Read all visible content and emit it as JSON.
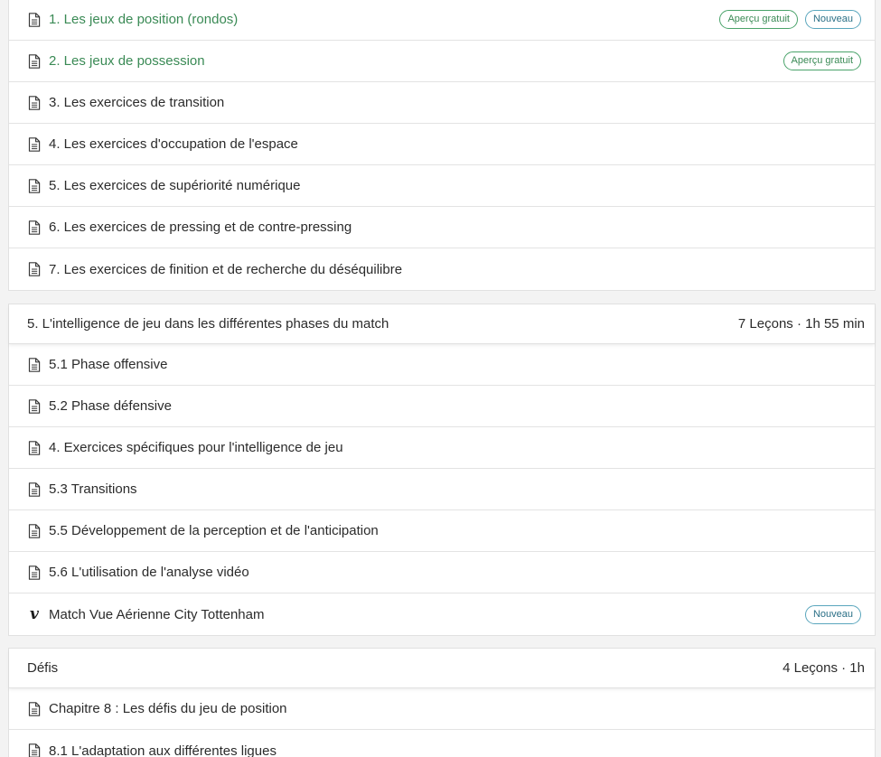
{
  "sections": [
    {
      "lessons": [
        {
          "icon": "document-icon",
          "label": "1. Les jeux de position (rondos)",
          "free": true,
          "badges": [
            "Aperçu gratuit",
            "Nouveau"
          ]
        },
        {
          "icon": "document-icon",
          "label": "2. Les jeux de possession",
          "free": true,
          "badges": [
            "Aperçu gratuit"
          ]
        },
        {
          "icon": "document-icon",
          "label": "3. Les exercices de transition",
          "free": false,
          "badges": []
        },
        {
          "icon": "document-icon",
          "label": "4. Les exercices d'occupation de l'espace",
          "free": false,
          "badges": []
        },
        {
          "icon": "document-icon",
          "label": "5. Les exercices de supériorité numérique",
          "free": false,
          "badges": []
        },
        {
          "icon": "document-icon",
          "label": "6. Les exercices de pressing et de contre-pressing",
          "free": false,
          "badges": []
        },
        {
          "icon": "document-icon",
          "label": "7. Les exercices de finition et de recherche du déséquilibre",
          "free": false,
          "badges": []
        }
      ]
    },
    {
      "title": "5. L'intelligence de jeu dans les différentes phases du match",
      "meta": "7 Leçons · 1h 55 min",
      "lessons": [
        {
          "icon": "document-icon",
          "label": "5.1 Phase offensive",
          "free": false,
          "badges": []
        },
        {
          "icon": "document-icon",
          "label": "5.2 Phase défensive",
          "free": false,
          "badges": []
        },
        {
          "icon": "document-icon",
          "label": "4. Exercices spécifiques pour l'intelligence de jeu",
          "free": false,
          "badges": []
        },
        {
          "icon": "document-icon",
          "label": "5.3 Transitions",
          "free": false,
          "badges": []
        },
        {
          "icon": "document-icon",
          "label": "5.5 Développement de la perception et de l'anticipation",
          "free": false,
          "badges": []
        },
        {
          "icon": "document-icon",
          "label": "5.6 L'utilisation de l'analyse vidéo",
          "free": false,
          "badges": []
        },
        {
          "icon": "vimeo-icon",
          "label": "Match Vue Aérienne City Tottenham",
          "free": false,
          "badges": [
            "Nouveau"
          ]
        }
      ]
    },
    {
      "title": "Défis",
      "meta": "4 Leçons · 1h",
      "lessons": [
        {
          "icon": "document-icon",
          "label": "Chapitre 8 : Les défis du jeu de position",
          "free": false,
          "badges": []
        },
        {
          "icon": "document-icon",
          "label": "8.1 L'adaptation aux différentes ligues",
          "free": false,
          "badges": []
        }
      ]
    }
  ],
  "colors": {
    "free_text": "#3a8a55",
    "preview_badge": "#4aa36a",
    "new_badge": "#5aa6bd"
  }
}
